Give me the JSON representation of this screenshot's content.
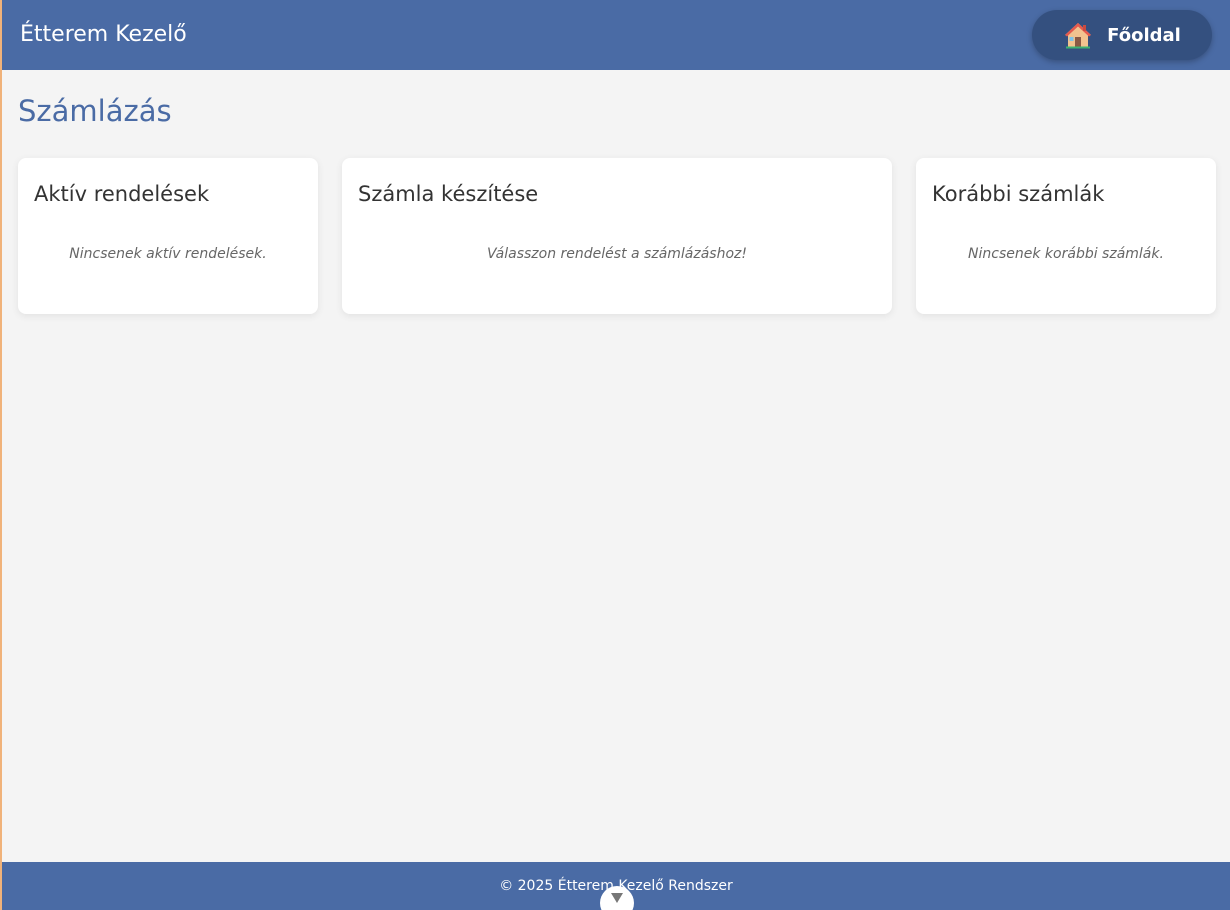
{
  "header": {
    "app_title": "Étterem Kezelő",
    "home_button_label": "Főoldal",
    "home_icon": "house-icon"
  },
  "page": {
    "title": "Számlázás"
  },
  "cards": [
    {
      "title": "Aktív rendelések",
      "empty_text": "Nincsenek aktív rendelések."
    },
    {
      "title": "Számla készítése",
      "empty_text": "Válasszon rendelést a számlázáshoz!"
    },
    {
      "title": "Korábbi számlák",
      "empty_text": "Nincsenek korábbi számlák."
    }
  ],
  "footer": {
    "text": "© 2025 Étterem Kezelő Rendszer",
    "scroll_icon": "chevron-down-icon"
  },
  "colors": {
    "primary": "#4a6ba5",
    "button_dark": "#34507f",
    "background": "#f4f4f4"
  }
}
